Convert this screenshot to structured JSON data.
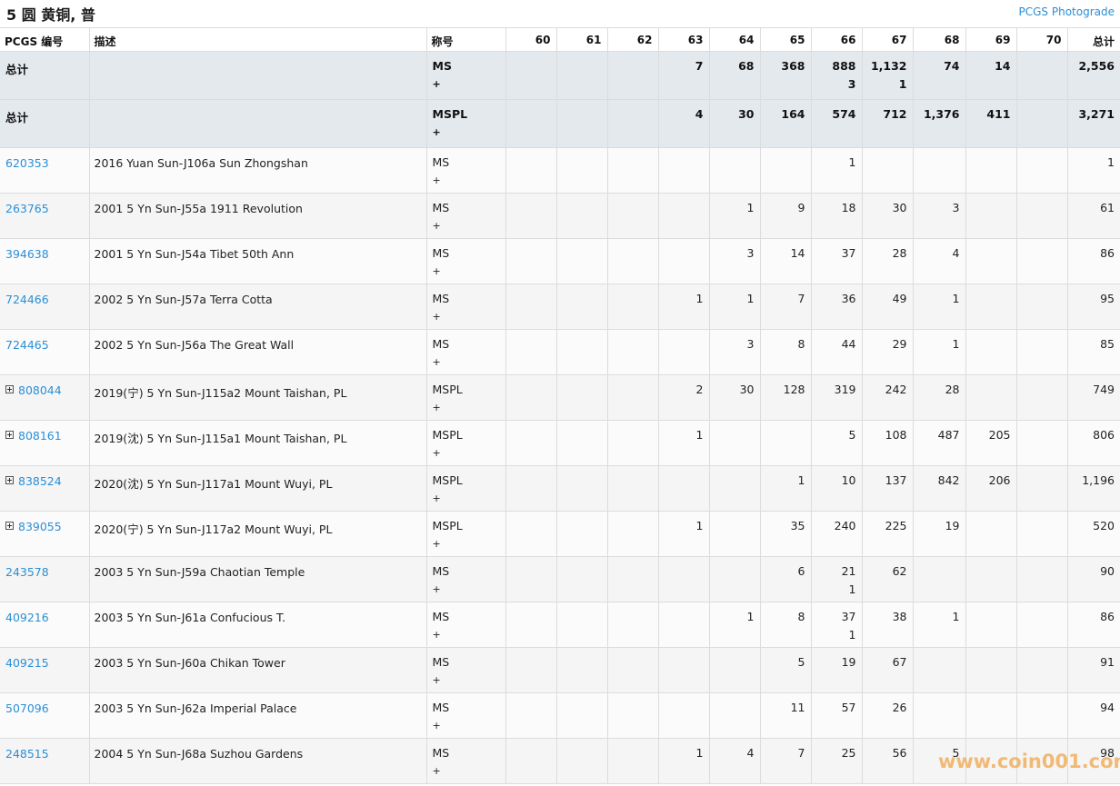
{
  "header": {
    "title": "5 圆 黄铜, 普",
    "photograde_link": "PCGS Photograde"
  },
  "table": {
    "columns": [
      "PCGS 编号",
      "描述",
      "称号",
      "60",
      "61",
      "62",
      "63",
      "64",
      "65",
      "66",
      "67",
      "68",
      "69",
      "70",
      "总计"
    ],
    "totals": [
      {
        "label": "总计",
        "designation": "MS",
        "plus": "+",
        "grades": [
          "",
          "",
          "",
          "7",
          "68",
          "368",
          "888\n3",
          "1,132\n1",
          "74",
          "14",
          ""
        ],
        "total": "2,556"
      },
      {
        "label": "总计",
        "designation": "MSPL",
        "plus": "+",
        "grades": [
          "",
          "",
          "",
          "4",
          "30",
          "164",
          "574",
          "712",
          "1,376",
          "411",
          ""
        ],
        "total": "3,271"
      }
    ],
    "rows": [
      {
        "pcgs": "620353",
        "expand": false,
        "description": "2016 Yuan Sun-J106a Sun Zhongshan",
        "designation": "MS",
        "plus": "+",
        "grades": [
          "",
          "",
          "",
          "",
          "",
          "",
          "1",
          "",
          "",
          "",
          ""
        ],
        "total": "1"
      },
      {
        "pcgs": "263765",
        "expand": false,
        "description": "2001 5 Yn Sun-J55a 1911 Revolution",
        "designation": "MS",
        "plus": "+",
        "grades": [
          "",
          "",
          "",
          "",
          "1",
          "9",
          "18",
          "30",
          "3",
          "",
          ""
        ],
        "total": "61"
      },
      {
        "pcgs": "394638",
        "expand": false,
        "description": "2001 5 Yn Sun-J54a Tibet 50th Ann",
        "designation": "MS",
        "plus": "+",
        "grades": [
          "",
          "",
          "",
          "",
          "3",
          "14",
          "37",
          "28",
          "4",
          "",
          ""
        ],
        "total": "86"
      },
      {
        "pcgs": "724466",
        "expand": false,
        "description": "2002 5 Yn Sun-J57a Terra Cotta",
        "designation": "MS",
        "plus": "+",
        "grades": [
          "",
          "",
          "",
          "1",
          "1",
          "7",
          "36",
          "49",
          "1",
          "",
          ""
        ],
        "total": "95"
      },
      {
        "pcgs": "724465",
        "expand": false,
        "description": "2002 5 Yn Sun-J56a The Great Wall",
        "designation": "MS",
        "plus": "+",
        "grades": [
          "",
          "",
          "",
          "",
          "3",
          "8",
          "44",
          "29",
          "1",
          "",
          ""
        ],
        "total": "85"
      },
      {
        "pcgs": "808044",
        "expand": true,
        "description": "2019(宁) 5 Yn Sun-J115a2 Mount Taishan, PL",
        "designation": "MSPL",
        "plus": "+",
        "grades": [
          "",
          "",
          "",
          "2",
          "30",
          "128",
          "319",
          "242",
          "28",
          "",
          ""
        ],
        "total": "749"
      },
      {
        "pcgs": "808161",
        "expand": true,
        "description": "2019(沈) 5 Yn Sun-J115a1 Mount Taishan, PL",
        "designation": "MSPL",
        "plus": "+",
        "grades": [
          "",
          "",
          "",
          "1",
          "",
          "",
          "5",
          "108",
          "487",
          "205",
          ""
        ],
        "total": "806"
      },
      {
        "pcgs": "838524",
        "expand": true,
        "description": "2020(沈) 5 Yn Sun-J117a1 Mount Wuyi, PL",
        "designation": "MSPL",
        "plus": "+",
        "grades": [
          "",
          "",
          "",
          "",
          "",
          "1",
          "10",
          "137",
          "842",
          "206",
          ""
        ],
        "total": "1,196"
      },
      {
        "pcgs": "839055",
        "expand": true,
        "description": "2020(宁) 5 Yn Sun-J117a2 Mount Wuyi, PL",
        "designation": "MSPL",
        "plus": "+",
        "grades": [
          "",
          "",
          "",
          "1",
          "",
          "35",
          "240",
          "225",
          "19",
          "",
          ""
        ],
        "total": "520"
      },
      {
        "pcgs": "243578",
        "expand": false,
        "description": "2003 5 Yn Sun-J59a Chaotian Temple",
        "designation": "MS",
        "plus": "+",
        "grades": [
          "",
          "",
          "",
          "",
          "",
          "6",
          "21\n1",
          "62",
          "",
          "",
          ""
        ],
        "total": "90"
      },
      {
        "pcgs": "409216",
        "expand": false,
        "description": "2003 5 Yn Sun-J61a Confucious T.",
        "designation": "MS",
        "plus": "+",
        "grades": [
          "",
          "",
          "",
          "",
          "1",
          "8",
          "37\n1",
          "38",
          "1",
          "",
          ""
        ],
        "total": "86"
      },
      {
        "pcgs": "409215",
        "expand": false,
        "description": "2003 5 Yn Sun-J60a Chikan Tower",
        "designation": "MS",
        "plus": "+",
        "grades": [
          "",
          "",
          "",
          "",
          "",
          "5",
          "19",
          "67",
          "",
          "",
          ""
        ],
        "total": "91"
      },
      {
        "pcgs": "507096",
        "expand": false,
        "description": "2003 5 Yn Sun-J62a Imperial Palace",
        "designation": "MS",
        "plus": "+",
        "grades": [
          "",
          "",
          "",
          "",
          "",
          "11",
          "57",
          "26",
          "",
          "",
          ""
        ],
        "total": "94"
      },
      {
        "pcgs": "248515",
        "expand": false,
        "description": "2004 5 Yn Sun-J68a Suzhou Gardens",
        "designation": "MS",
        "plus": "+",
        "grades": [
          "",
          "",
          "",
          "1",
          "4",
          "7",
          "25",
          "56",
          "5",
          "",
          ""
        ],
        "total": "98"
      }
    ]
  },
  "watermark": "www.coin001.com"
}
